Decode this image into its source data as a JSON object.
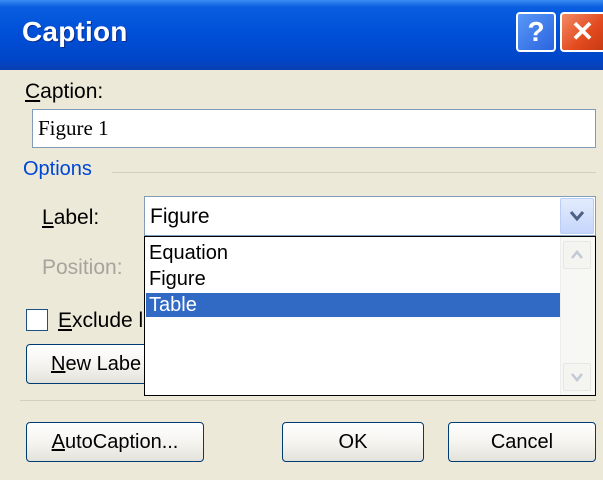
{
  "dialog": {
    "title": "Caption",
    "help_glyph": "?",
    "close_glyph": "✕"
  },
  "caption": {
    "label_mnemonic": "C",
    "label_rest": "aption:",
    "value": "Figure 1"
  },
  "options": {
    "title": "Options",
    "label_mnemonic": "L",
    "label_rest": "abel:",
    "label_value": "Figure",
    "position_label": "Position:",
    "dropdown_items": [
      "Equation",
      "Figure",
      "Table"
    ],
    "selected_index": 2
  },
  "exclude": {
    "mnemonic": "E",
    "rest": "xclude l"
  },
  "buttons": {
    "new_label_mnemonic": "N",
    "new_label_rest": "ew Labe",
    "autocaption_mnemonic": "A",
    "autocaption_rest": "utoCaption...",
    "ok": "OK",
    "cancel": "Cancel"
  },
  "colors": {
    "titlebar": "#0050d8",
    "selection": "#316ac5",
    "group_title": "#0046d5",
    "dialog_bg": "#ece9d8"
  },
  "icons": [
    "help-icon",
    "close-icon",
    "chevron-down-icon",
    "scroll-up-icon",
    "scroll-down-icon"
  ]
}
